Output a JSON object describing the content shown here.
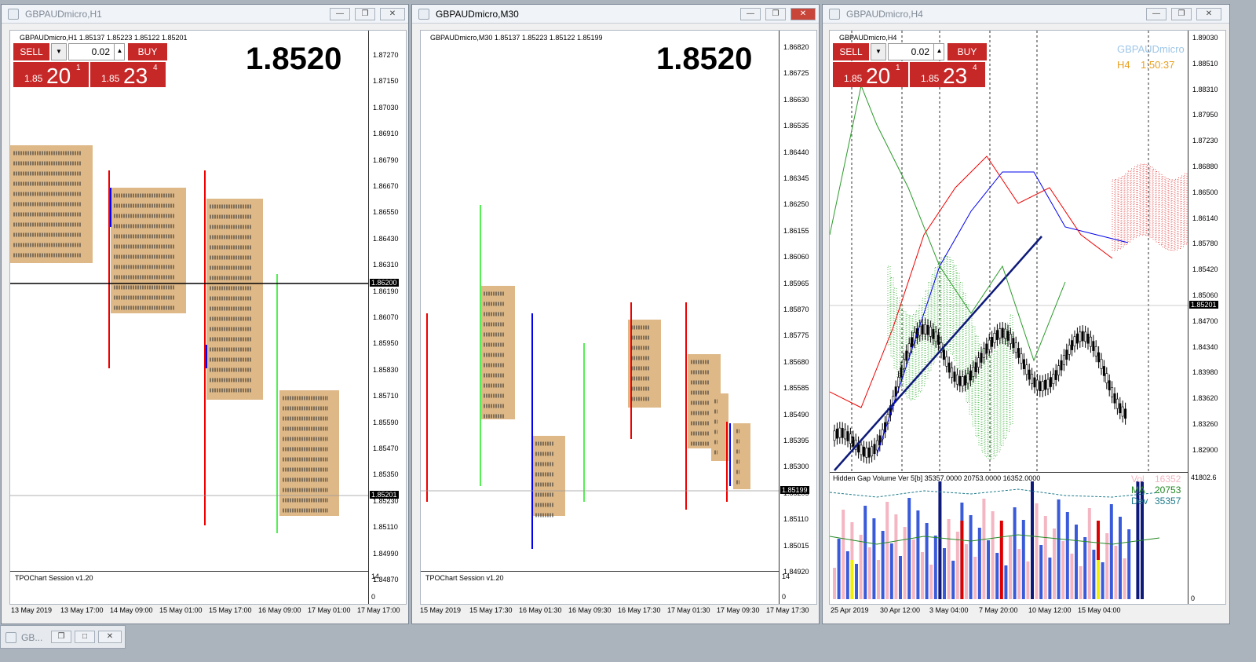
{
  "windows": [
    {
      "title": "GBPAUDmicro,H1",
      "chart_header": "GBPAUDmicro,H1  1.85137 1.85223 1.85122 1.85201",
      "big_price": "1.8520",
      "current_price": "1.85201",
      "lots": "0.02",
      "sell_label": "SELL",
      "buy_label": "BUY",
      "bid_small": "1.85",
      "bid_big": "20",
      "bid_tiny": "1",
      "ask_small": "1.85",
      "ask_big": "23",
      "ask_tiny": "4",
      "session_label": "TPOChart Session v1.20",
      "line_price": "1.86200",
      "y_ticks": [
        "1.87270",
        "1.87150",
        "1.87030",
        "1.86910",
        "1.86790",
        "1.86670",
        "1.86550",
        "1.86430",
        "1.86310",
        "1.86190",
        "1.86070",
        "1.85950",
        "1.85830",
        "1.85710",
        "1.85590",
        "1.85470",
        "1.85350",
        "1.85230",
        "1.85110",
        "1.84990",
        "1.84870"
      ],
      "sub_ticks": [
        "14",
        "0"
      ],
      "x_ticks": [
        "13 May 2019",
        "13 May 17:00",
        "14 May 09:00",
        "15 May 01:00",
        "15 May 17:00",
        "16 May 09:00",
        "17 May 01:00",
        "17 May 17:00"
      ]
    },
    {
      "title": "GBPAUDmicro,M30",
      "chart_header": "GBPAUDmicro,M30  1.85137 1.85223 1.85122 1.85199",
      "big_price": "1.8520",
      "current_price": "1.85199",
      "session_label": "TPOChart Session v1.20",
      "y_ticks": [
        "1.86820",
        "1.86725",
        "1.86630",
        "1.86535",
        "1.86440",
        "1.86345",
        "1.86250",
        "1.86155",
        "1.86060",
        "1.85965",
        "1.85870",
        "1.85775",
        "1.85680",
        "1.85585",
        "1.85490",
        "1.85395",
        "1.85300",
        "1.85205",
        "1.85110",
        "1.85015",
        "1.84920"
      ],
      "sub_ticks": [
        "14",
        "0"
      ],
      "x_ticks": [
        "15 May 2019",
        "15 May 17:30",
        "16 May 01:30",
        "16 May 09:30",
        "16 May 17:30",
        "17 May 01:30",
        "17 May 09:30",
        "17 May 17:30"
      ]
    },
    {
      "title": "GBPAUDmicro,H4",
      "chart_header": "GBPAUDmicro,H4",
      "lots": "0.02",
      "sell_label": "SELL",
      "buy_label": "BUY",
      "bid_small": "1.85",
      "bid_big": "20",
      "bid_tiny": "1",
      "ask_small": "1.85",
      "ask_big": "23",
      "ask_tiny": "4",
      "symbol_watermark": "GBPAUDmicro",
      "tf_label": "H4",
      "timer": "1:50:37",
      "current_price": "1.85201",
      "y_ticks": [
        "1.89030",
        "1.88510",
        "1.88310",
        "1.87950",
        "1.87230",
        "1.86880",
        "1.86500",
        "1.86140",
        "1.85780",
        "1.85420",
        "1.85060",
        "1.84700",
        "1.84340",
        "1.83980",
        "1.83620",
        "1.83260",
        "1.82900"
      ],
      "volume_title": "Hidden Gap Volume Ver 5[b] 35357.0000 20753.0000 16352.0000",
      "vol_label": "Vol",
      "vol_value": "16352",
      "ma_label": "MA",
      "ma_value": "20753",
      "dev_label": "Dev",
      "dev_value": "35357",
      "vol_axis_top": "41802.6",
      "vol_axis_bottom": "0",
      "x_ticks": [
        "25 Apr 2019",
        "30 Apr 12:00",
        "3 May 04:00",
        "7 May 20:00",
        "10 May 12:00",
        "15 May 04:00"
      ]
    }
  ],
  "taskbar": {
    "label": "GB..."
  },
  "colors": {
    "tpo_box": "#deb887",
    "tpo_red": "#e00000",
    "tpo_blue": "#0000ee",
    "sell_buy": "#c62828",
    "vol_blue": "#3a5bd9",
    "vol_pink": "#f4b6c2",
    "vol_navy": "#0d1a7a",
    "vol_red": "#dd0000",
    "vol_yellow": "#f0f000",
    "cloud_green": "#2aaa2a",
    "cloud_red": "#e03030"
  }
}
